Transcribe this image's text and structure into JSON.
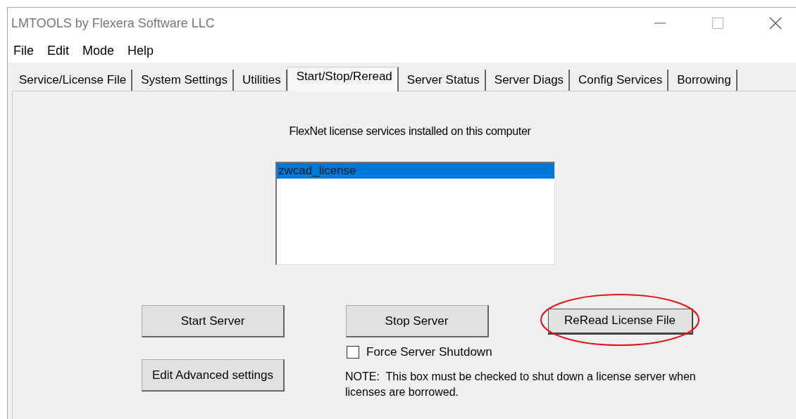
{
  "window": {
    "title": "LMTOOLS by Flexera Software LLC"
  },
  "menu": [
    "File",
    "Edit",
    "Mode",
    "Help"
  ],
  "tabs": [
    {
      "label": "Service/License File",
      "selected": false
    },
    {
      "label": "System Settings",
      "selected": false
    },
    {
      "label": "Utilities",
      "selected": false
    },
    {
      "label": "Start/Stop/Reread",
      "selected": true
    },
    {
      "label": "Server Status",
      "selected": false
    },
    {
      "label": "Server Diags",
      "selected": false
    },
    {
      "label": "Config Services",
      "selected": false
    },
    {
      "label": "Borrowing",
      "selected": false
    }
  ],
  "services_label": "FlexNet license services installed on this computer",
  "services": [
    {
      "name": "zwcad_license",
      "selected": true
    }
  ],
  "buttons": [
    {
      "label": "Start Server",
      "highlighted": false
    },
    {
      "label": "Stop Server",
      "highlighted": false
    },
    {
      "label": "ReRead License File",
      "highlighted": true
    },
    {
      "label": "Edit Advanced settings",
      "highlighted": false
    }
  ],
  "force_shutdown": {
    "label": "Force Server Shutdown",
    "checked": false
  },
  "note": "NOTE:  This box must be checked to shut down a license server when licenses are borrowed."
}
